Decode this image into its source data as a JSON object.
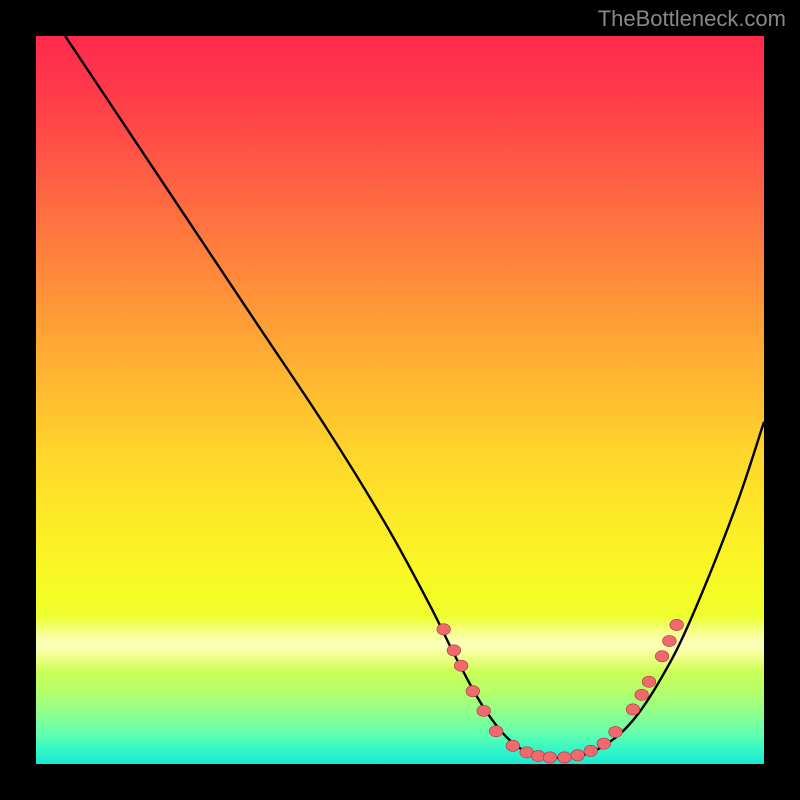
{
  "watermark": "TheBottleneck.com",
  "colors": {
    "background": "#000000",
    "curve": "#000000",
    "dot_fill": "#ef6a6f",
    "dot_stroke": "#a83438",
    "gradient_top": "#ff2a4d",
    "gradient_bottom": "#1be8d0"
  },
  "chart_data": {
    "type": "line",
    "title": "",
    "xlabel": "",
    "ylabel": "",
    "xlim": [
      0,
      100
    ],
    "ylim": [
      0,
      100
    ],
    "series": [
      {
        "name": "bottleneck-curve",
        "x": [
          4,
          10,
          20,
          30,
          40,
          48,
          54,
          58,
          62,
          66,
          70,
          74,
          78,
          82,
          86,
          90,
          96,
          100
        ],
        "y": [
          100,
          91,
          76,
          61,
          46,
          33,
          22,
          14,
          7,
          2.5,
          1,
          1,
          2.5,
          6,
          12,
          20,
          35,
          47
        ]
      }
    ],
    "dot_clusters": [
      {
        "name": "left-arm-dots",
        "points": [
          {
            "x": 56.0,
            "y": 18.5
          },
          {
            "x": 57.4,
            "y": 15.6
          },
          {
            "x": 58.4,
            "y": 13.5
          },
          {
            "x": 60.0,
            "y": 10.0
          },
          {
            "x": 61.5,
            "y": 7.3
          }
        ]
      },
      {
        "name": "trough-dots",
        "points": [
          {
            "x": 63.2,
            "y": 4.5
          },
          {
            "x": 65.5,
            "y": 2.5
          },
          {
            "x": 67.4,
            "y": 1.6
          },
          {
            "x": 69.0,
            "y": 1.1
          },
          {
            "x": 70.6,
            "y": 0.9
          },
          {
            "x": 72.6,
            "y": 0.9
          },
          {
            "x": 74.4,
            "y": 1.2
          },
          {
            "x": 76.2,
            "y": 1.8
          },
          {
            "x": 78.0,
            "y": 2.8
          },
          {
            "x": 79.6,
            "y": 4.4
          }
        ]
      },
      {
        "name": "right-arm-dots",
        "points": [
          {
            "x": 82.0,
            "y": 7.5
          },
          {
            "x": 83.2,
            "y": 9.5
          },
          {
            "x": 84.2,
            "y": 11.3
          },
          {
            "x": 86.0,
            "y": 14.8
          },
          {
            "x": 87.0,
            "y": 16.9
          },
          {
            "x": 88.0,
            "y": 19.1
          }
        ]
      }
    ]
  }
}
